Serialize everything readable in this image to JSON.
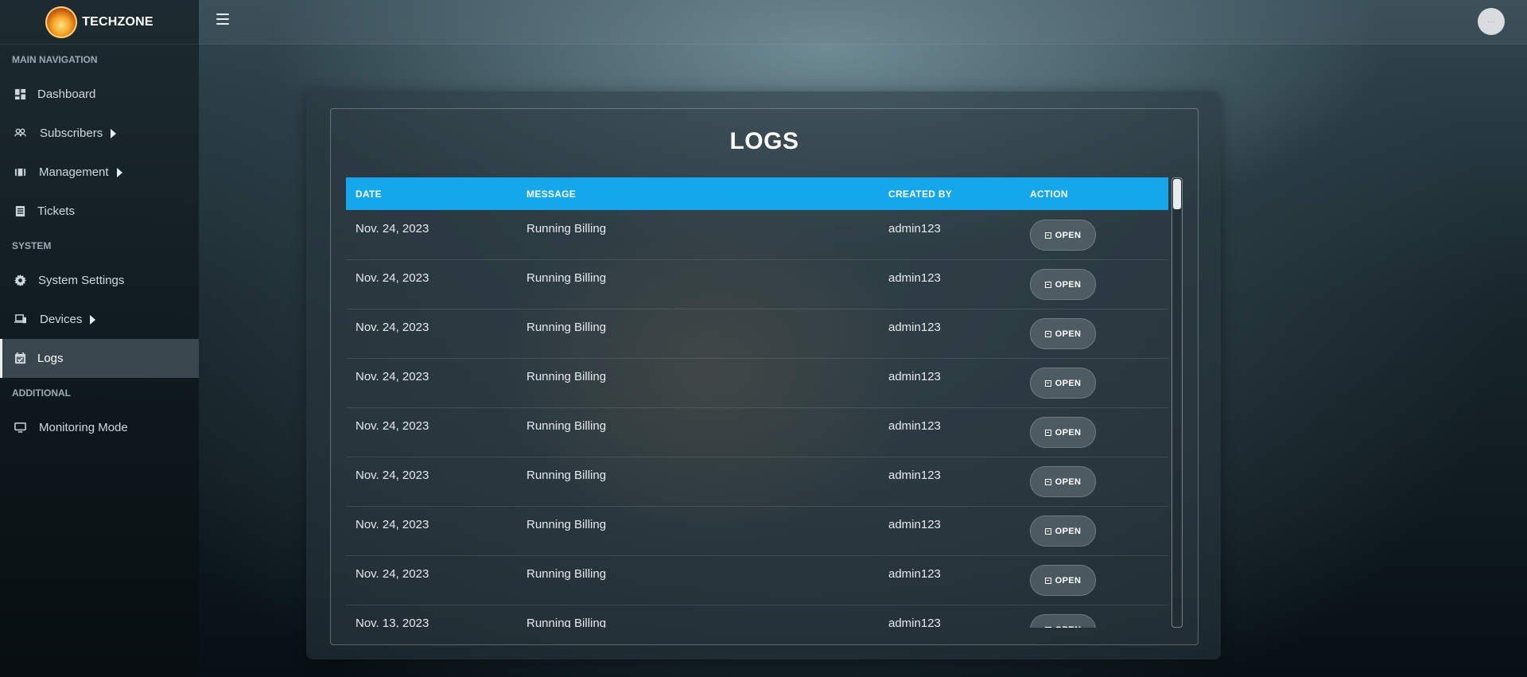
{
  "brand": {
    "name": "TECHZONE"
  },
  "sidebar": {
    "sections": [
      {
        "header": "MAIN NAVIGATION"
      },
      {
        "header": "SYSTEM"
      },
      {
        "header": "ADDITIONAL"
      }
    ],
    "items": [
      {
        "label": "Dashboard",
        "icon": "dashboard-icon"
      },
      {
        "label": "Subscribers",
        "icon": "users-icon"
      },
      {
        "label": "Management",
        "icon": "film-icon"
      },
      {
        "label": "Tickets",
        "icon": "ticket-list-icon"
      },
      {
        "label": "System Settings",
        "icon": "gear-icon"
      },
      {
        "label": "Devices",
        "icon": "devices-icon"
      },
      {
        "label": "Logs",
        "icon": "calendar-check-icon"
      },
      {
        "label": "Monitoring Mode",
        "icon": "monitor-icon"
      }
    ]
  },
  "topbar": {
    "avatar_text": "···"
  },
  "page": {
    "title": "LOGS"
  },
  "table": {
    "headers": {
      "date": "DATE",
      "message": "MESSAGE",
      "created_by": "CREATED BY",
      "action": "ACTION"
    },
    "action_label": "OPEN",
    "rows": [
      {
        "date": "Nov. 24, 2023",
        "message": "Running Billing",
        "created_by": "admin123"
      },
      {
        "date": "Nov. 24, 2023",
        "message": "Running Billing",
        "created_by": "admin123"
      },
      {
        "date": "Nov. 24, 2023",
        "message": "Running Billing",
        "created_by": "admin123"
      },
      {
        "date": "Nov. 24, 2023",
        "message": "Running Billing",
        "created_by": "admin123"
      },
      {
        "date": "Nov. 24, 2023",
        "message": "Running Billing",
        "created_by": "admin123"
      },
      {
        "date": "Nov. 24, 2023",
        "message": "Running Billing",
        "created_by": "admin123"
      },
      {
        "date": "Nov. 24, 2023",
        "message": "Running Billing",
        "created_by": "admin123"
      },
      {
        "date": "Nov. 24, 2023",
        "message": "Running Billing",
        "created_by": "admin123"
      },
      {
        "date": "Nov. 13, 2023",
        "message": "Running Billing",
        "created_by": "admin123"
      }
    ]
  },
  "colors": {
    "header_blue": "#14a8ea"
  }
}
